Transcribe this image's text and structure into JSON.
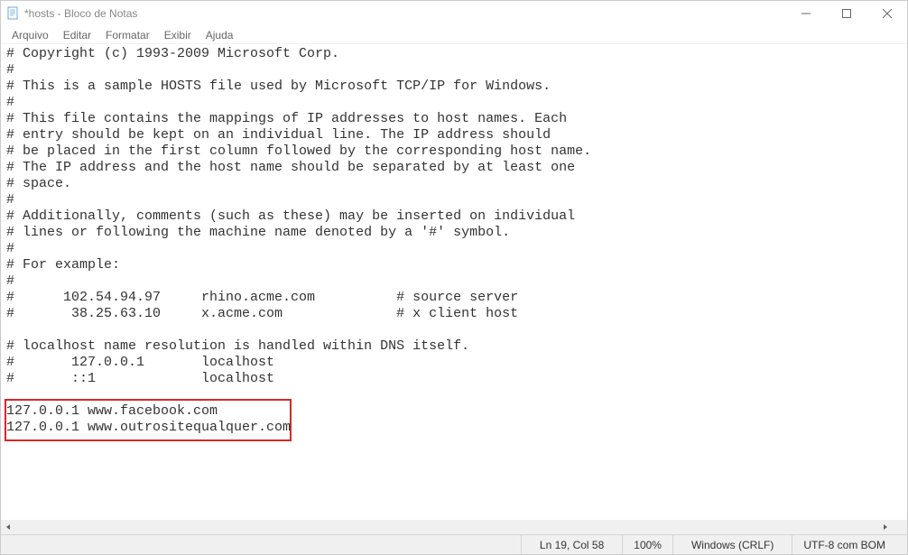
{
  "window": {
    "title": "*hosts - Bloco de Notas"
  },
  "menu": {
    "file": "Arquivo",
    "edit": "Editar",
    "format": "Formatar",
    "view": "Exibir",
    "help": "Ajuda"
  },
  "content": "# Copyright (c) 1993-2009 Microsoft Corp.\n#\n# This is a sample HOSTS file used by Microsoft TCP/IP for Windows.\n#\n# This file contains the mappings of IP addresses to host names. Each\n# entry should be kept on an individual line. The IP address should\n# be placed in the first column followed by the corresponding host name.\n# The IP address and the host name should be separated by at least one\n# space.\n#\n# Additionally, comments (such as these) may be inserted on individual\n# lines or following the machine name denoted by a '#' symbol.\n#\n# For example:\n#\n#      102.54.94.97     rhino.acme.com          # source server\n#       38.25.63.10     x.acme.com              # x client host\n\n# localhost name resolution is handled within DNS itself.\n#\t127.0.0.1       localhost\n#\t::1             localhost\n\n127.0.0.1 www.facebook.com\n127.0.0.1 www.outrositequalquer.com",
  "status": {
    "position": "Ln 19, Col 58",
    "zoom": "100%",
    "line_ending": "Windows (CRLF)",
    "encoding": "UTF-8 com BOM"
  }
}
